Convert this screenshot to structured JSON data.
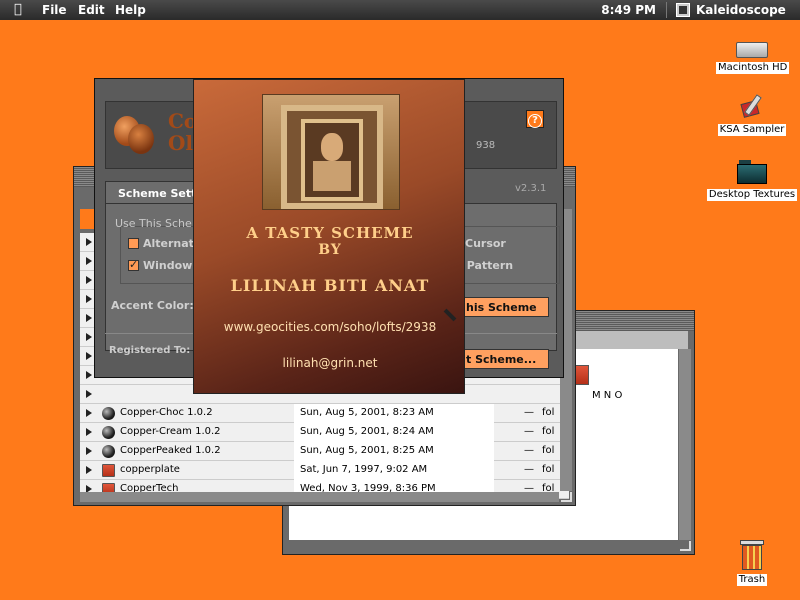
{
  "menubar": {
    "menus": [
      "File",
      "Edit",
      "Help"
    ],
    "clock": "8:49 PM",
    "app_name": "Kaleidoscope"
  },
  "desktop": {
    "icons": [
      {
        "label": "Macintosh HD",
        "icon": "hard-drive-icon"
      },
      {
        "label": "KSA Sampler",
        "icon": "app-icon"
      },
      {
        "label": "Desktop Textures",
        "icon": "folder-icon"
      },
      {
        "label": "Trash",
        "icon": "trash-icon"
      }
    ]
  },
  "panel": {
    "title_line1": "Co",
    "title_line2": "Ol",
    "reg_number": "938",
    "tab_label": "Scheme Sett",
    "version": "v2.3.1",
    "use_label": "Use This Sche",
    "cb_alternate": "Alternat",
    "cb_window": "Window",
    "cb_cursor": "Cursor",
    "cb_pattern": "p Pattern",
    "accent_label": "Accent Color:",
    "use_scheme_button": "his Scheme",
    "registered_label": "Registered To:",
    "select_scheme_button": "t Scheme..."
  },
  "splash": {
    "line1": "A TASTY SCHEME",
    "line2": "BY",
    "author": "LILINAH BITI ANAT",
    "url": "www.geocities.com/soho/lofts/2938",
    "email": "lilinah@grin.net"
  },
  "scheme_list": {
    "rows": [
      {
        "name": "Copper-Choc 1.0.2",
        "date": "Sun, Aug 5, 2001, 8:23 AM",
        "size": "—",
        "kind": "fol",
        "icon": "ball"
      },
      {
        "name": "Copper-Cream 1.0.2",
        "date": "Sun, Aug 5, 2001, 8:24 AM",
        "size": "—",
        "kind": "fol",
        "icon": "ball"
      },
      {
        "name": "CopperPeaked 1.0.2",
        "date": "Sun, Aug 5, 2001, 8:25 AM",
        "size": "—",
        "kind": "fol",
        "icon": "ball"
      },
      {
        "name": "copperplate",
        "date": "Sat, Jun 7, 1997, 9:02 AM",
        "size": "—",
        "kind": "fol",
        "icon": "doc"
      },
      {
        "name": "CopperTech",
        "date": "Wed, Nov 3, 1999, 8:36 PM",
        "size": "—",
        "kind": "fol",
        "icon": "doc"
      }
    ]
  },
  "back_window": {
    "fragment": "M N O"
  }
}
